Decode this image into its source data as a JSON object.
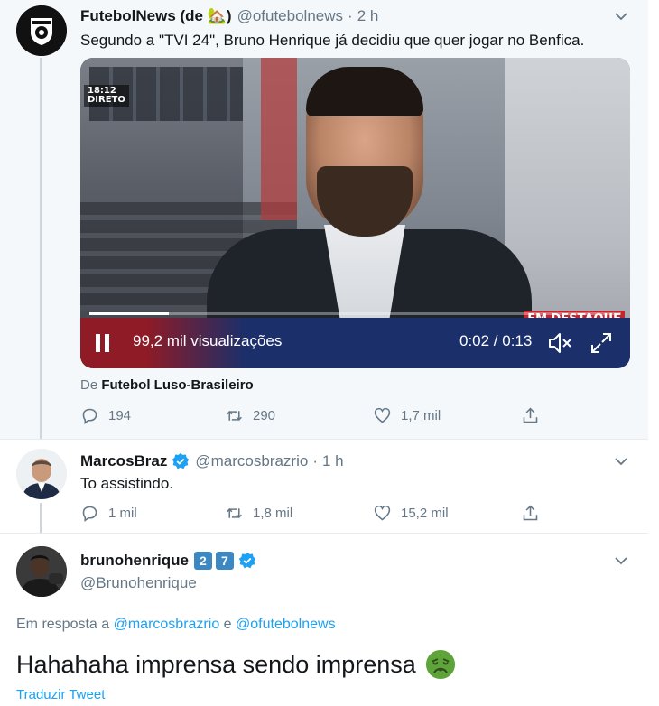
{
  "tweets": [
    {
      "name": "FutebolNews (de 🏡)",
      "handle": "@ofutebolnews",
      "time": "2 h",
      "text": "Segundo a \"TVI 24\", Bruno Henrique já decidiu que quer jogar no Benfica.",
      "video": {
        "clock_time": "18:12",
        "clock_label": "DIRETO",
        "banner": "EM DESTAQUE",
        "views": "99,2 mil visualizações",
        "time": "0:02 / 0:13",
        "progress": 0.15
      },
      "source_prefix": "De",
      "source_name": "Futebol Luso-Brasileiro",
      "replies": "194",
      "retweets": "290",
      "likes": "1,7 mil"
    },
    {
      "name": "MarcosBraz",
      "handle": "@marcosbrazrio",
      "time": "1 h",
      "text": "To assistindo.",
      "replies": "1 mil",
      "retweets": "1,8 mil",
      "likes": "15,2 mil"
    },
    {
      "name": "brunohenrique",
      "badge1": "2",
      "badge2": "7",
      "handle": "@Brunohenrique",
      "replying_prefix": "Em resposta a",
      "mention1": "@marcosbrazrio",
      "replying_and": "e",
      "mention2": "@ofutebolnews",
      "text": "Hahahaha imprensa sendo imprensa",
      "translate": "Traduzir Tweet"
    }
  ],
  "colors": {
    "accent": "#1da1f2",
    "muted": "#657786",
    "verified": "#1da1f2",
    "nauseated_face": "#5ea43a"
  }
}
